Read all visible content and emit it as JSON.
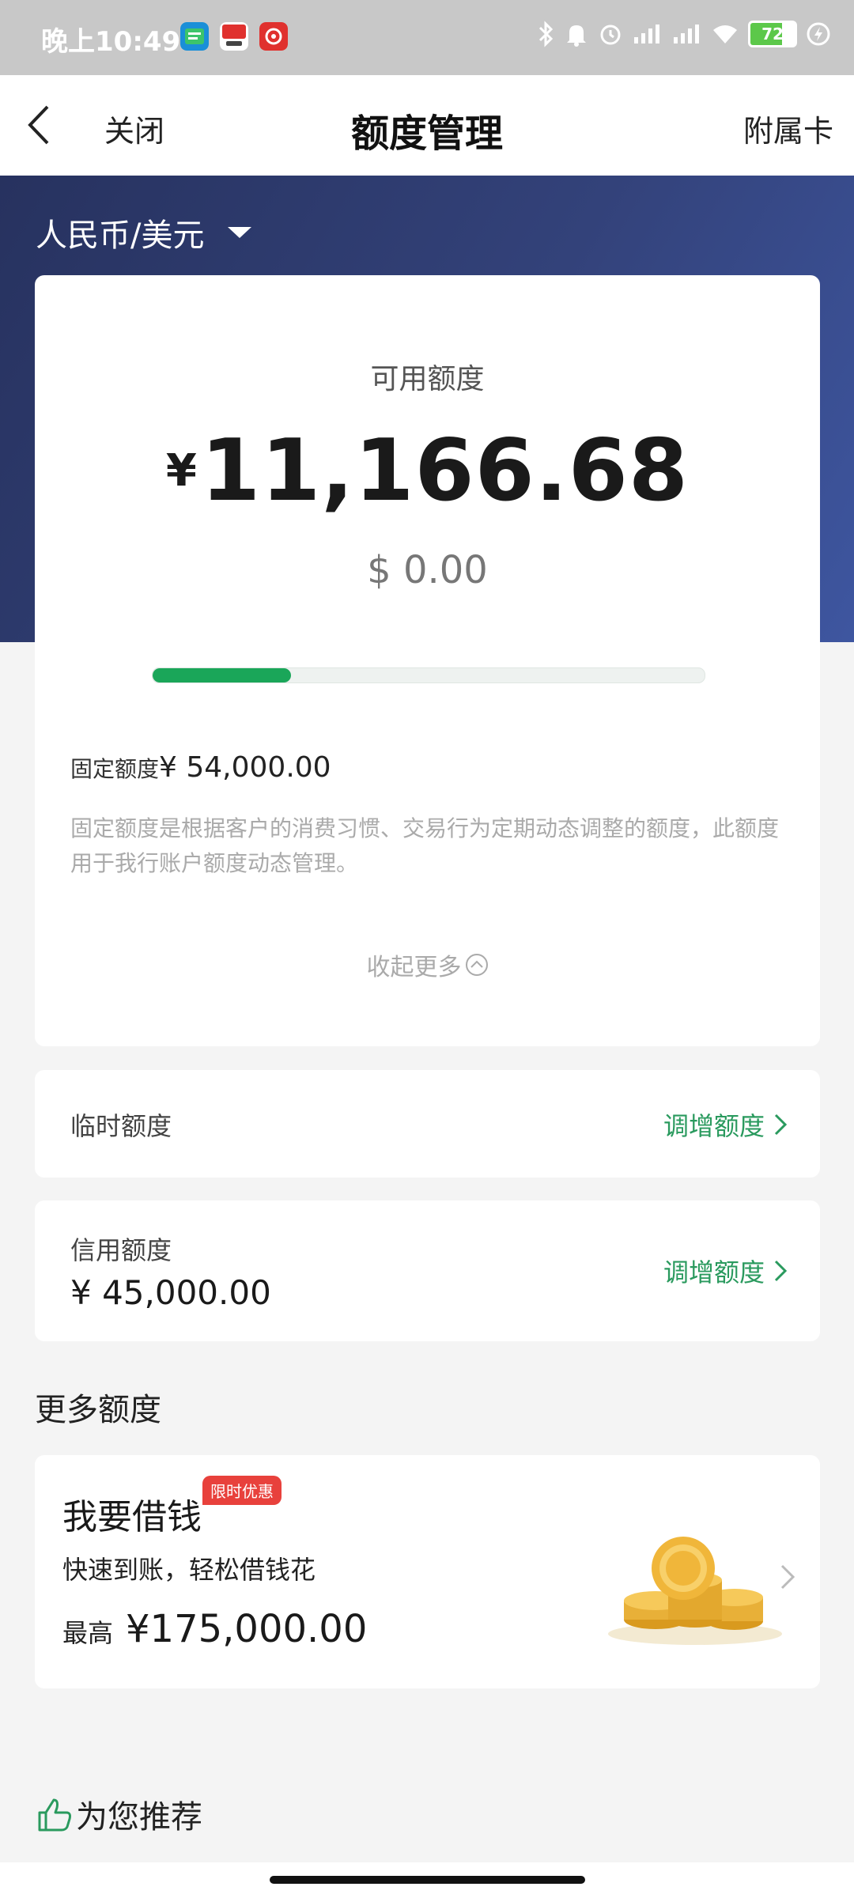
{
  "status_bar": {
    "time": "晚上10:49",
    "battery": "72",
    "battery_level_percent": 72,
    "icons": [
      "bluetooth-icon",
      "bell-icon",
      "alarm-icon",
      "signal-icon",
      "signal-icon",
      "wifi-icon",
      "battery-icon",
      "charging-icon"
    ],
    "apps": [
      "app-icon-1",
      "app-icon-2",
      "app-icon-3"
    ]
  },
  "nav": {
    "close": "关闭",
    "title": "额度管理",
    "supplementary_card": "附属卡"
  },
  "currency_selector": "人民币/美元",
  "available": {
    "label": "可用额度",
    "cny_sign": "¥",
    "cny_amount": "11,166.68",
    "usd": "$ 0.00",
    "usage_fraction": 0.25
  },
  "fixed_limit": {
    "label": "固定额度",
    "value": "¥ 54,000.00",
    "description": "固定额度是根据客户的消费习惯、交易行为定期动态调整的额度，此额度用于我行账户额度动态管理。",
    "collapse": "收起更多"
  },
  "temporary_limit": {
    "label": "临时额度",
    "action": "调增额度"
  },
  "credit_limit": {
    "label": "信用额度",
    "value": "¥ 45,000.00",
    "action": "调增额度"
  },
  "more_limits": {
    "heading": "更多额度",
    "loan": {
      "title": "我要借钱",
      "badge": "限时优惠",
      "desc": "快速到账，轻松借钱花",
      "max_label": "最高",
      "max_value": "¥175,000.00"
    }
  },
  "recommend": "为您推荐",
  "colors": {
    "accent_green": "#1aa659",
    "action_green": "#2a9a5e",
    "hero_blue": "#33427a",
    "badge_red": "#e8413c"
  }
}
